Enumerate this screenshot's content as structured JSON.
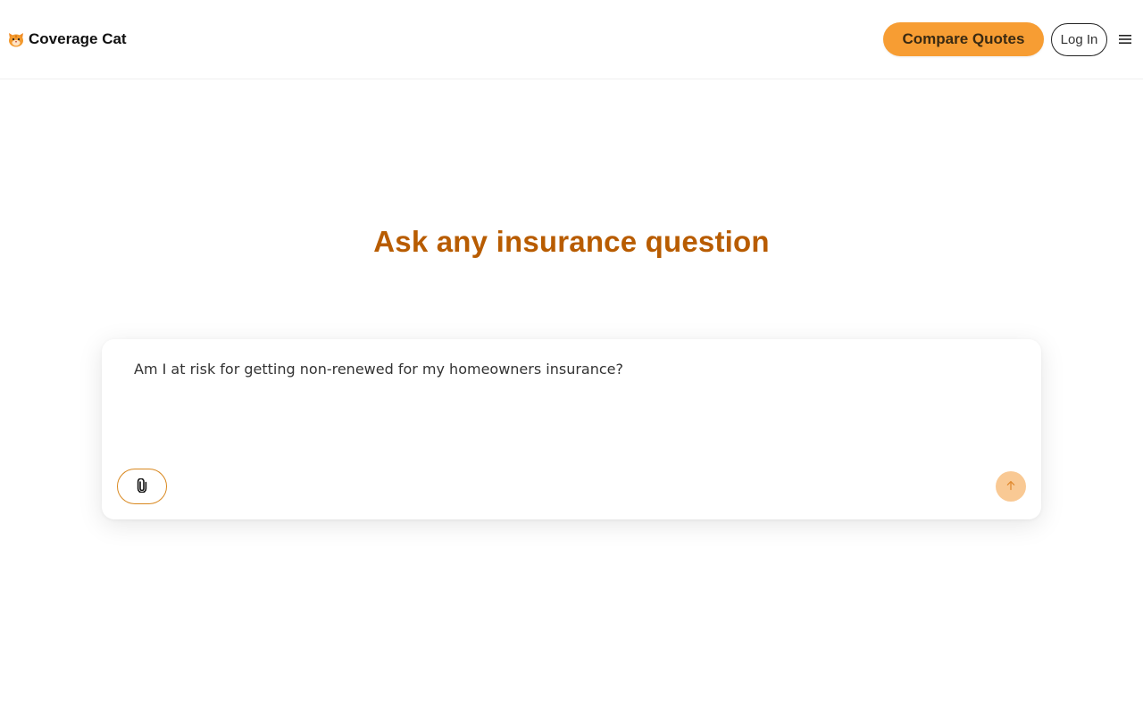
{
  "header": {
    "brand_name": "Coverage Cat",
    "brand_icon": "cat-face-icon",
    "compare_quotes_label": "Compare Quotes",
    "login_label": "Log In",
    "menu_icon": "hamburger-menu-icon"
  },
  "hero": {
    "title": "Ask any insurance question"
  },
  "chat": {
    "input_value": "Am I at risk for getting non-renewed for my homeowners insurance?",
    "attach_icon": "paperclip-icon",
    "send_icon": "arrow-up-icon"
  },
  "colors": {
    "accent": "#f79d33",
    "title": "#b85c00",
    "send_disabled": "#f9c994",
    "attach_border": "#d9881f"
  }
}
